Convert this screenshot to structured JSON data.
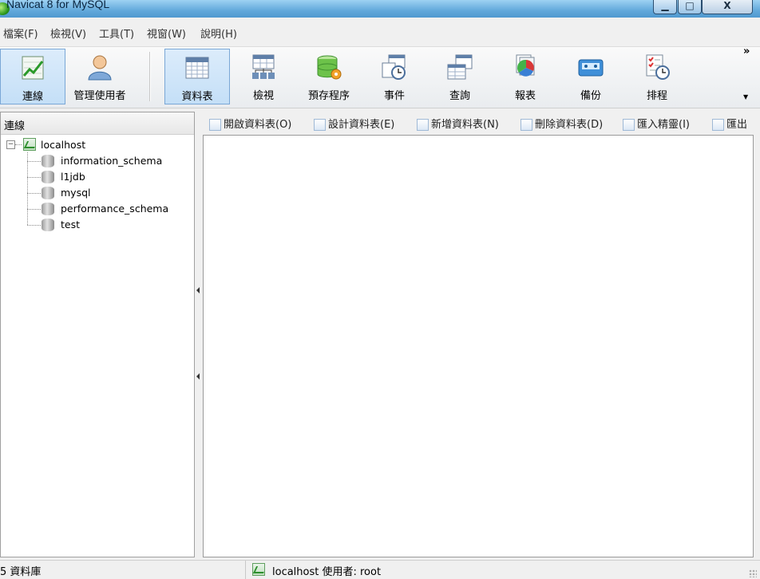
{
  "window": {
    "title": "Navicat 8 for MySQL",
    "controls": {
      "minimize": "▁",
      "maximize": "□",
      "close": "X"
    }
  },
  "menu": {
    "items": [
      "檔案(F)",
      "檢視(V)",
      "工具(T)",
      "視窗(W)",
      "說明(H)"
    ]
  },
  "toolbar": {
    "buttons": [
      {
        "label": "連線",
        "icon": "connection-icon",
        "active": true
      },
      {
        "label": "管理使用者",
        "icon": "user-icon",
        "active": false
      },
      {
        "label": "資料表",
        "icon": "table-icon",
        "active": true
      },
      {
        "label": "檢視",
        "icon": "view-icon",
        "active": false
      },
      {
        "label": "預存程序",
        "icon": "procedure-icon",
        "active": false
      },
      {
        "label": "事件",
        "icon": "event-icon",
        "active": false
      },
      {
        "label": "查詢",
        "icon": "query-icon",
        "active": false
      },
      {
        "label": "報表",
        "icon": "report-icon",
        "active": false
      },
      {
        "label": "備份",
        "icon": "backup-icon",
        "active": false
      },
      {
        "label": "排程",
        "icon": "schedule-icon",
        "active": false
      }
    ],
    "more": "»",
    "dropdown": "▼"
  },
  "left_panel": {
    "header": "連線",
    "tree": {
      "connection": {
        "name": "localhost",
        "expander": "−"
      },
      "databases": [
        "information_schema",
        "l1jdb",
        "mysql",
        "performance_schema",
        "test"
      ]
    }
  },
  "object_toolbar": {
    "items": [
      "開啟資料表(O)",
      "設計資料表(E)",
      "新增資料表(N)",
      "刪除資料表(D)",
      "匯入精靈(I)",
      "匯出"
    ]
  },
  "statusbar": {
    "db_count": "5 資料庫",
    "connection_info": "localhost  使用者: root"
  },
  "colors": {
    "titlebar": "#62a9db",
    "active_tool": "#c4dff7",
    "panel_bg": "#ffffff",
    "chrome_bg": "#f0f0f0"
  }
}
